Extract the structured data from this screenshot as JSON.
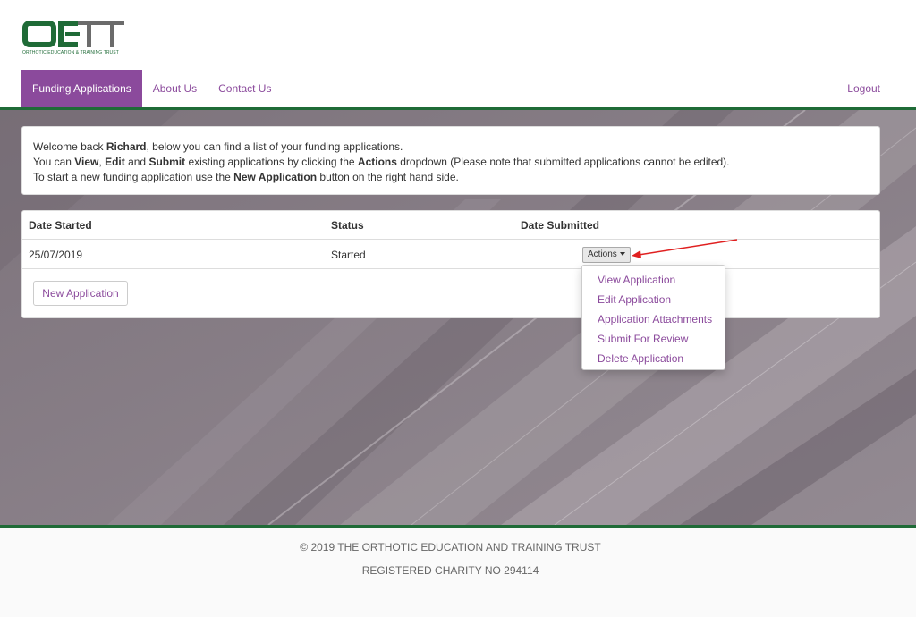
{
  "logo": {
    "letters": "OETT",
    "tagline": "ORTHOTIC EDUCATION & TRAINING TRUST"
  },
  "nav": {
    "items": [
      {
        "label": "Funding Applications",
        "active": true
      },
      {
        "label": "About Us",
        "active": false
      },
      {
        "label": "Contact Us",
        "active": false
      }
    ],
    "logout": "Logout"
  },
  "welcome": {
    "line1_prefix": "Welcome back ",
    "user": "Richard",
    "line1_suffix": ", below you can find a list of your funding applications.",
    "line2_a": "You can ",
    "line2_view": "View",
    "line2_b": ", ",
    "line2_edit": "Edit",
    "line2_c": " and ",
    "line2_submit": "Submit",
    "line2_d": " existing applications by clicking the ",
    "line2_actions": "Actions",
    "line2_e": " dropdown (Please note that submitted applications cannot be edited).",
    "line3_a": "To start a new funding application use the ",
    "line3_new": "New Application",
    "line3_b": " button on the right hand side."
  },
  "table": {
    "headers": [
      "Date Started",
      "Status",
      "Date Submitted"
    ],
    "rows": [
      {
        "date_started": "25/07/2019",
        "status": "Started",
        "date_submitted": ""
      }
    ],
    "actions_label": "Actions",
    "new_application": "New Application"
  },
  "dropdown": {
    "items": [
      "View Application",
      "Edit Application",
      "Application Attachments",
      "Submit For Review",
      "Delete Application"
    ]
  },
  "footer": {
    "copyright": "© 2019 THE ORTHOTIC EDUCATION AND TRAINING TRUST",
    "charity": "REGISTERED CHARITY NO 294114"
  },
  "colors": {
    "brand_green": "#1f6b37",
    "accent_purple": "#8b4a9c",
    "annotation_red": "#e02020"
  }
}
